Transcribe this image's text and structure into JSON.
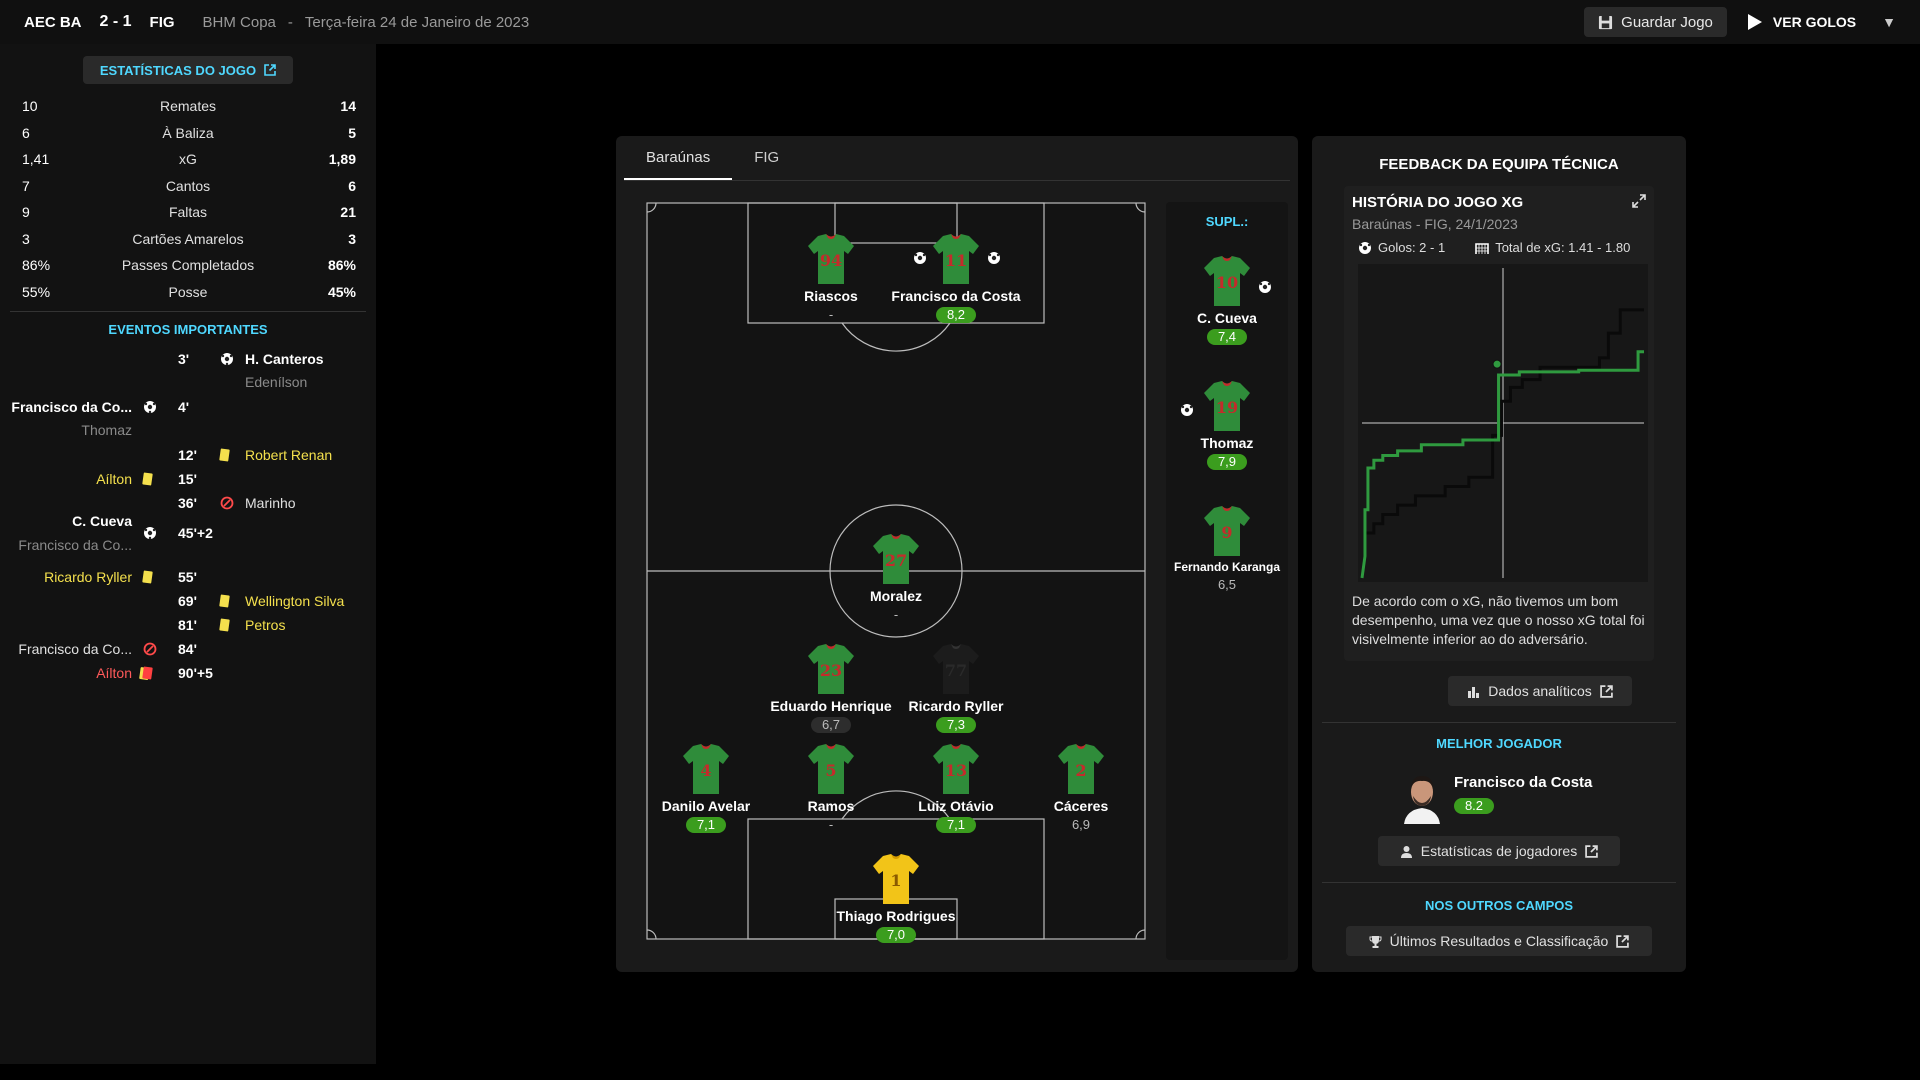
{
  "topbar": {
    "home": "AEC BA",
    "score": "2 - 1",
    "away": "FIG",
    "competition": "BHM Copa",
    "separator": "-",
    "date": "Terça-feira 24 de Janeiro de 2023",
    "save_label": "Guardar Jogo",
    "goals_label": "VER GOLOS"
  },
  "match_stats": {
    "button_label": "ESTATÍSTICAS DO JOGO",
    "rows": [
      {
        "home": "10",
        "label": "Remates",
        "away": "14"
      },
      {
        "home": "6",
        "label": "À Baliza",
        "away": "5"
      },
      {
        "home": "1,41",
        "label": "xG",
        "away": "1,89"
      },
      {
        "home": "7",
        "label": "Cantos",
        "away": "6"
      },
      {
        "home": "9",
        "label": "Faltas",
        "away": "21"
      },
      {
        "home": "3",
        "label": "Cartões Amarelos",
        "away": "3"
      },
      {
        "home": "86%",
        "label": "Passes Completados",
        "away": "86%"
      },
      {
        "home": "55%",
        "label": "Posse",
        "away": "45%"
      }
    ]
  },
  "events": {
    "title": "EVENTOS IMPORTANTES",
    "items": [
      {
        "minute": "3'",
        "right": "H. Canteros",
        "right_sub": "Edenílson"
      },
      {
        "minute": "4'",
        "left": "Francisco da Co...",
        "left_sub": "Thomaz"
      },
      {
        "minute": "12'",
        "right": "Robert Renan"
      },
      {
        "minute": "15'",
        "left": "Aílton"
      },
      {
        "minute": "36'",
        "right": "Marinho"
      },
      {
        "minute": "45'+2",
        "left": "C. Cueva",
        "left_sub": "Francisco da Co..."
      },
      {
        "minute": "55'",
        "left": "Ricardo Ryller"
      },
      {
        "minute": "69'",
        "right": "Wellington Silva"
      },
      {
        "minute": "81'",
        "right": "Petros"
      },
      {
        "minute": "84'",
        "left": "Francisco da Co..."
      },
      {
        "minute": "90'+5",
        "left": "Aílton"
      }
    ]
  },
  "lineup": {
    "tabs": [
      "Baraúnas",
      "FIG"
    ],
    "subs_title": "SUPL.:",
    "players": [
      {
        "name": "Riascos",
        "number": "94",
        "rating": "-"
      },
      {
        "name": "Francisco da Costa",
        "number": "11",
        "rating": "8,2"
      },
      {
        "name": "Moralez",
        "number": "27",
        "rating": "-"
      },
      {
        "name": "Eduardo Henrique",
        "number": "23",
        "rating": "6,7"
      },
      {
        "name": "Ricardo Ryller",
        "number": "77",
        "rating": "7,3"
      },
      {
        "name": "Danilo Avelar",
        "number": "4",
        "rating": "7,1"
      },
      {
        "name": "Ramos",
        "number": "5",
        "rating": "-"
      },
      {
        "name": "Luiz Otávio",
        "number": "13",
        "rating": "7,1"
      },
      {
        "name": "Cáceres",
        "number": "2",
        "rating": "6,9"
      },
      {
        "name": "Thiago Rodrigues",
        "number": "1",
        "rating": "7,0"
      }
    ],
    "subs": [
      {
        "name": "C. Cueva",
        "number": "10",
        "rating": "7,4"
      },
      {
        "name": "Thomaz",
        "number": "19",
        "rating": "7,9"
      },
      {
        "name": "Fernando Karanga",
        "number": "9",
        "rating": "6,5"
      }
    ],
    "colors": {
      "shirt": "#2f8c3a",
      "shirt_accent": "#c42b2b",
      "keeper": "#f2c418",
      "rating_green": "#3b9d1e"
    }
  },
  "feedback": {
    "title": "FEEDBACK DA EQUIPA TÉCNICA",
    "xg_title": "HISTÓRIA DO JOGO XG",
    "xg_subtitle": "Baraúnas - FIG, 24/1/2023",
    "goals_label": "Golos: 2 - 1",
    "xg_total_label": "Total de xG: 1.41 - 1.80",
    "comment": "De acordo com o xG, não tivemos um bom desempenho, uma vez que o nosso xG total foi visivelmente inferior ao do adversário.",
    "analytics_label": "Dados analíticos",
    "best_title": "MELHOR JOGADOR",
    "best_name": "Francisco da Costa",
    "best_rating": "8.2",
    "player_stats_label": "Estatísticas de jogadores",
    "other_fields_title": "NOS OUTROS CAMPOS",
    "results_label": "Últimos Resultados e Classificação"
  },
  "chart_data": {
    "type": "line",
    "title": "HISTÓRIA DO JOGO XG",
    "xlabel": "",
    "ylabel": "",
    "xlim": [
      0,
      95
    ],
    "ylim": [
      0,
      2.0
    ],
    "grid": true,
    "series": [
      {
        "name": "Baraúnas",
        "color": "#2f9a3f",
        "points": [
          [
            0,
            0
          ],
          [
            1,
            0.14
          ],
          [
            1,
            0.44
          ],
          [
            2,
            0.44
          ],
          [
            2,
            0.71
          ],
          [
            4,
            0.71
          ],
          [
            4,
            0.76
          ],
          [
            7,
            0.76
          ],
          [
            7,
            0.79
          ],
          [
            12,
            0.79
          ],
          [
            12,
            0.82
          ],
          [
            20,
            0.82
          ],
          [
            20,
            0.86
          ],
          [
            34,
            0.86
          ],
          [
            34,
            0.89
          ],
          [
            46,
            0.89
          ],
          [
            46,
            1.31
          ],
          [
            53,
            1.31
          ],
          [
            53,
            1.33
          ],
          [
            73,
            1.33
          ],
          [
            73,
            1.34
          ],
          [
            93,
            1.34
          ],
          [
            93,
            1.46
          ],
          [
            95,
            1.46
          ]
        ]
      },
      {
        "name": "FIG",
        "color": "#000000",
        "points": [
          [
            0,
            0
          ],
          [
            1,
            0.14
          ],
          [
            1,
            0.29
          ],
          [
            4,
            0.29
          ],
          [
            4,
            0.35
          ],
          [
            7,
            0.35
          ],
          [
            7,
            0.41
          ],
          [
            12,
            0.41
          ],
          [
            12,
            0.47
          ],
          [
            18,
            0.47
          ],
          [
            18,
            0.53
          ],
          [
            28,
            0.53
          ],
          [
            28,
            0.59
          ],
          [
            36,
            0.59
          ],
          [
            36,
            0.65
          ],
          [
            44,
            0.65
          ],
          [
            44,
            0.92
          ],
          [
            47,
            0.92
          ],
          [
            47,
            1.14
          ],
          [
            50,
            1.14
          ],
          [
            50,
            1.23
          ],
          [
            54,
            1.23
          ],
          [
            54,
            1.28
          ],
          [
            60,
            1.28
          ],
          [
            60,
            1.36
          ],
          [
            80,
            1.36
          ],
          [
            80,
            1.42
          ],
          [
            83,
            1.42
          ],
          [
            83,
            1.58
          ],
          [
            87,
            1.58
          ],
          [
            87,
            1.73
          ],
          [
            95,
            1.73
          ]
        ]
      }
    ]
  }
}
